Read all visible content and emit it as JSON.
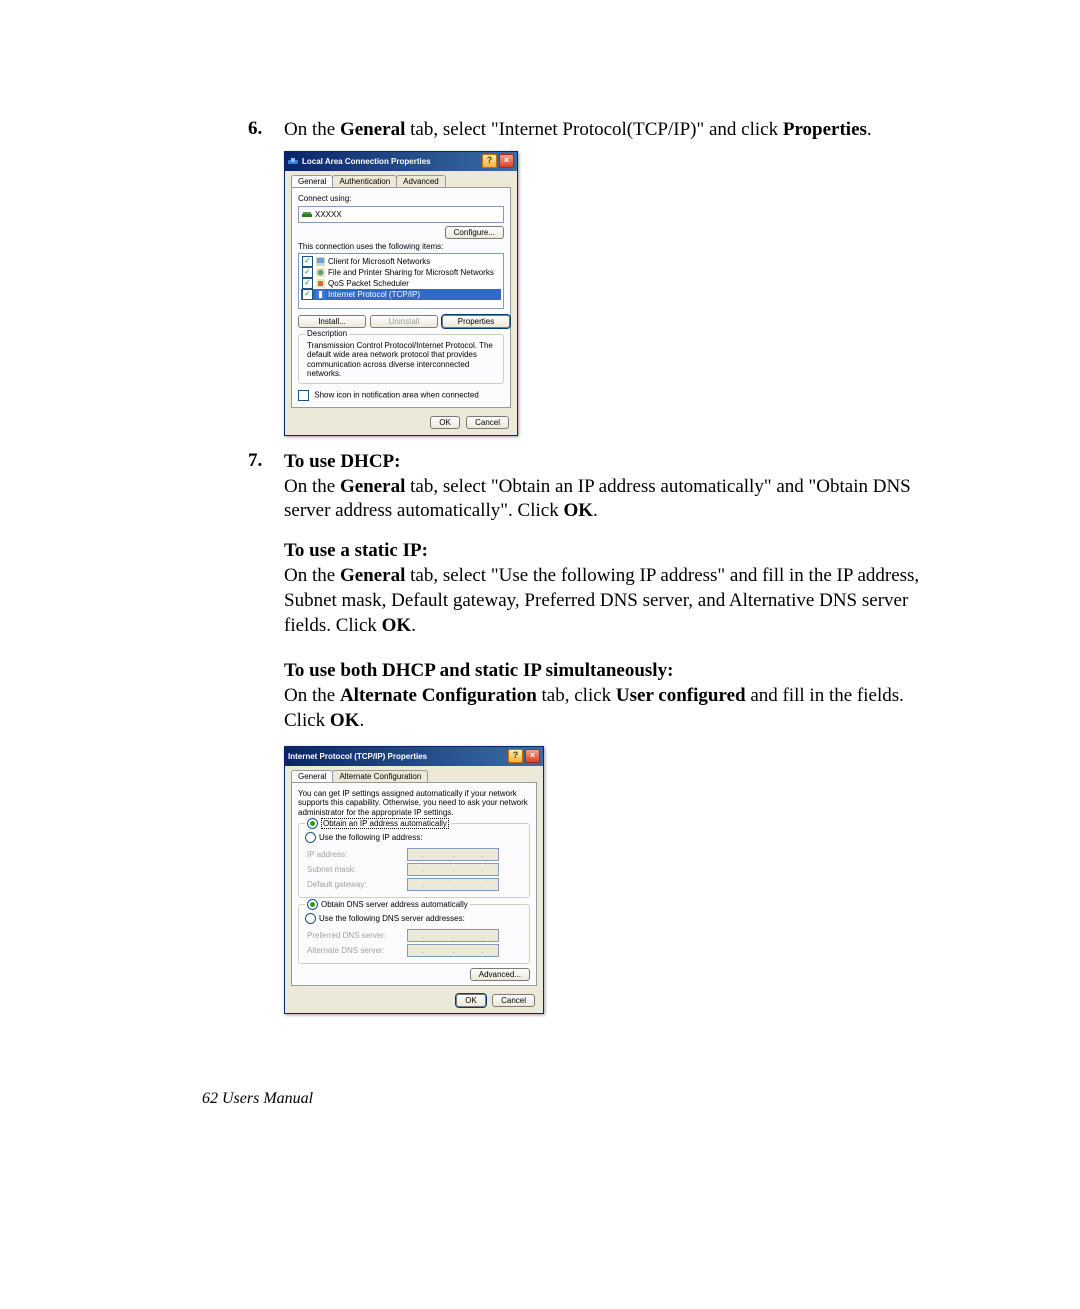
{
  "steps": {
    "six": {
      "num": "6.",
      "pre": "On the ",
      "bold1": "General",
      "mid1": " tab, select \"Internet Protocol(TCP/IP)\" and click ",
      "bold2": "Properties",
      "post": "."
    },
    "seven": {
      "num": "7.",
      "head": "To use DHCP:",
      "pre": "On the ",
      "bold1": "General",
      "mid1": " tab, select \"Obtain an IP address automatically\" and \"Obtain DNS server address automatically\". Click ",
      "bold2": "OK",
      "post": "."
    }
  },
  "static_section": {
    "head": "To use a static IP:",
    "pre": "On the ",
    "bold1": "General",
    "mid1": " tab, select \"Use the following IP address\" and fill in the IP address, Subnet mask, Default gateway, Preferred DNS server, and Alternative DNS server fields. Click ",
    "bold2": "OK",
    "post": "."
  },
  "both_section": {
    "head": "To use both DHCP and static IP simultaneously:",
    "pre": "On the ",
    "bold1": "Alternate Configuration",
    "mid1": " tab, click ",
    "bold2": "User configured",
    "mid2": " and fill in the fields. Click ",
    "bold3": "OK",
    "post": "."
  },
  "footer": "62  Users Manual",
  "dlg1": {
    "title": "Local Area Connection Properties",
    "tabs": [
      "General",
      "Authentication",
      "Advanced"
    ],
    "connect_using_label": "Connect using:",
    "adapter": "XXXXX",
    "configure_btn": "Configure...",
    "uses_label": "This connection uses the following items:",
    "items": [
      {
        "check": true,
        "label": "Client for Microsoft Networks"
      },
      {
        "check": true,
        "label": "File and Printer Sharing for Microsoft Networks"
      },
      {
        "check": true,
        "label": "QoS Packet Scheduler"
      },
      {
        "check": true,
        "label": "Internet Protocol (TCP/IP)",
        "selected": true
      }
    ],
    "install_btn": "Install...",
    "uninstall_btn": "Uninstall",
    "properties_btn": "Properties",
    "desc_head": "Description",
    "desc_text": "Transmission Control Protocol/Internet Protocol. The default wide area network protocol that provides communication across diverse interconnected networks.",
    "show_icon": "Show icon in notification area when connected",
    "ok": "OK",
    "cancel": "Cancel"
  },
  "dlg2": {
    "title": "Internet Protocol (TCP/IP) Properties",
    "tabs": [
      "General",
      "Alternate Configuration"
    ],
    "intro": "You can get IP settings assigned automatically if your network supports this capability. Otherwise, you need to ask your network administrator for the appropriate IP settings.",
    "opt_auto_ip": "Obtain an IP address automatically",
    "opt_static_ip": "Use the following IP address:",
    "ip_label": "IP address:",
    "mask_label": "Subnet mask:",
    "gw_label": "Default gateway:",
    "opt_auto_dns": "Obtain DNS server address automatically",
    "opt_static_dns": "Use the following DNS server addresses:",
    "pref_dns": "Preferred DNS server:",
    "alt_dns": "Alternate DNS server:",
    "advanced_btn": "Advanced...",
    "ok": "OK",
    "cancel": "Cancel"
  }
}
